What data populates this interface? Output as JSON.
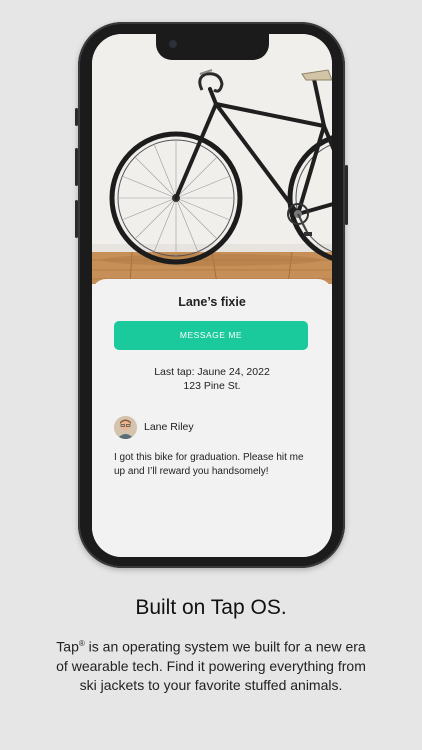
{
  "card": {
    "title": "Lane’s fixie",
    "message_button": "MESSAGE ME",
    "last_tap": "Last tap: Jaune 24, 2022",
    "address": "123 Pine St.",
    "owner_name": "Lane Riley",
    "note": "I got this bike for graduation. Please hit me up and I’ll reward you handsomely!"
  },
  "promo": {
    "headline": "Built on Tap OS.",
    "description_brand": "Tap",
    "description_mark": "®",
    "description": " is an operating system we built for a new era of wearable tech. Find it powering everything from ski jackets to your favorite stuffed animals."
  },
  "colors": {
    "accent": "#1ac99c",
    "background": "#e6e6e6",
    "card": "#f2f2f2"
  },
  "icons": [
    "bike-photo",
    "avatar"
  ]
}
